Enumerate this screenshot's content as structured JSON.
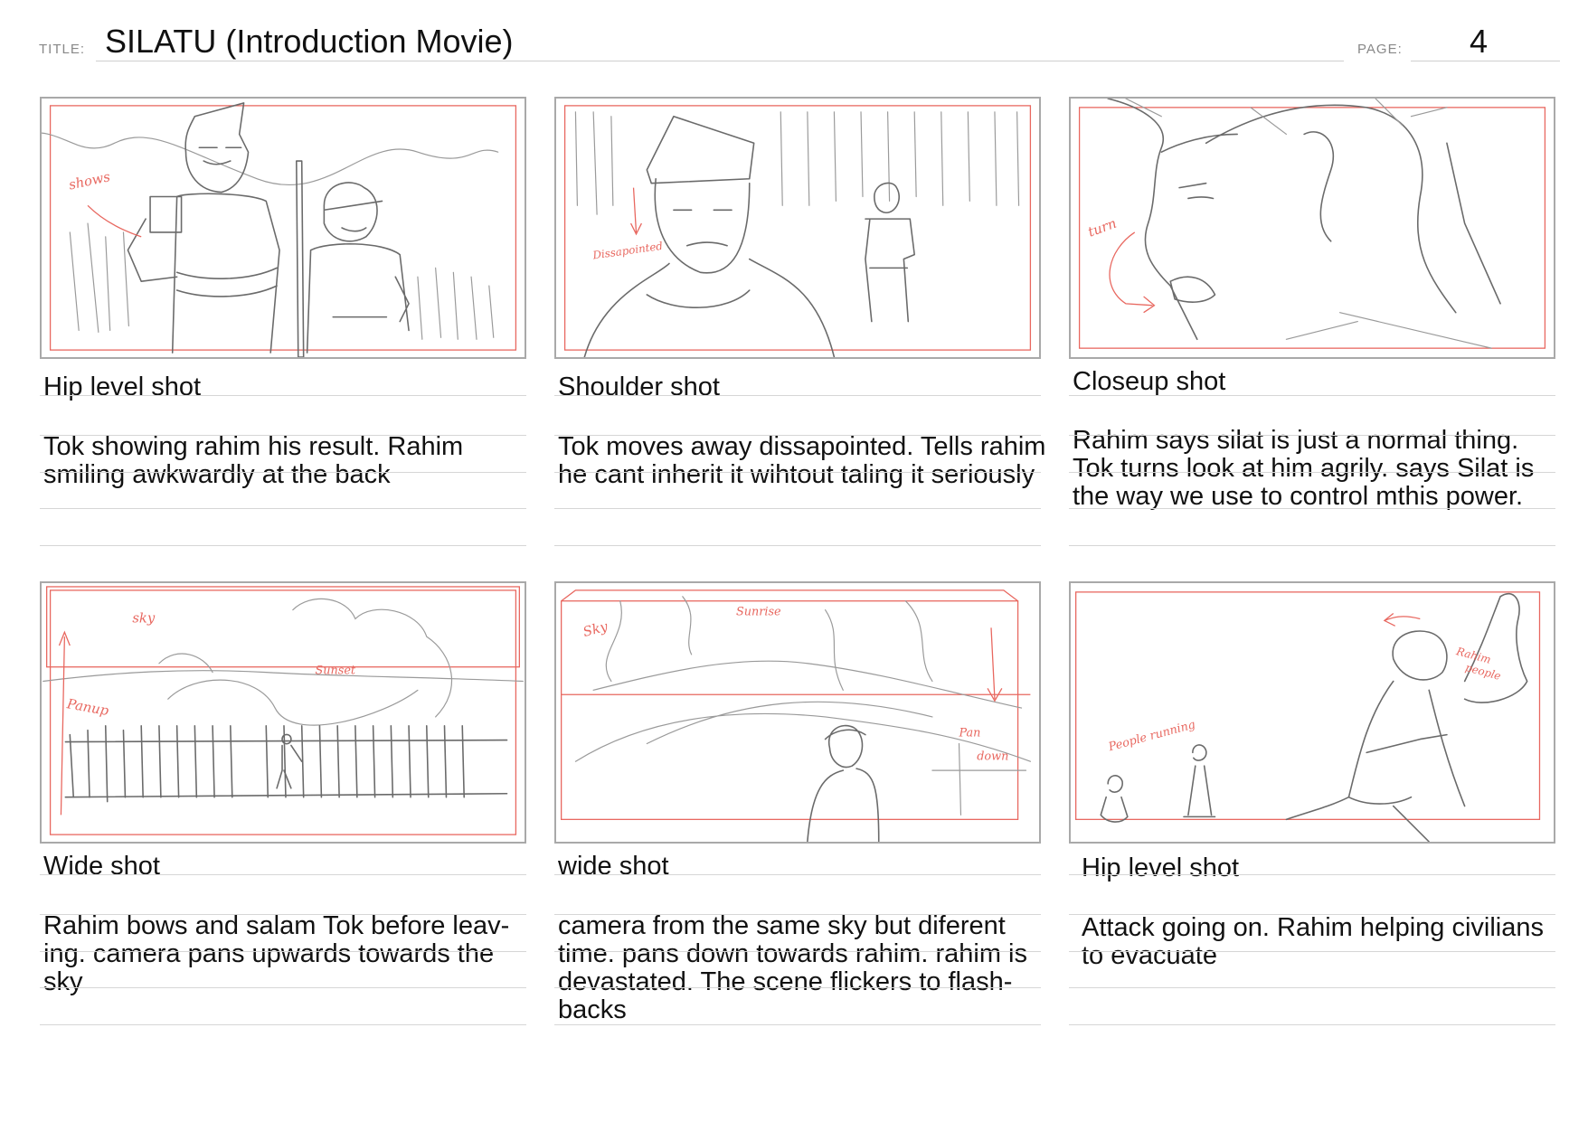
{
  "header": {
    "title_label": "TITLE:",
    "title": "SILATU (Introduction Movie)",
    "page_label": "PAGE:",
    "page_number": "4"
  },
  "panels": [
    {
      "shot": "Hip level shot",
      "description": "Tok showing rahim his result. Rahim smiling awkwardly at the back",
      "annotations": [
        "shows"
      ]
    },
    {
      "shot": "Shoulder shot",
      "description": "Tok moves away dissapointed. Tells rahim he cant inherit it wihtout taling it seriously",
      "annotations": [
        "Dissapointed"
      ]
    },
    {
      "shot": "Closeup shot",
      "description": "Rahim says silat is just a normal thing. Tok turns look at him agrily. says Silat is the way we use to control mthis power.",
      "annotations": [
        "turn"
      ]
    },
    {
      "shot": "Wide shot",
      "description": "Rahim bows and salam Tok before leav-ing. camera pans upwards towards the sky",
      "annotations": [
        "sky",
        "Sunset",
        "Panup"
      ]
    },
    {
      "shot": "wide shot",
      "description": "camera from the  same sky but diferent time. pans down towards rahim. rahim is devastated. The scene flickers to flash-backs",
      "annotations": [
        "Sky",
        "Sunrise",
        "Pan",
        "down"
      ]
    },
    {
      "shot": "Hip level shot",
      "description": "Attack going on. Rahim helping civilians to evacuate",
      "annotations": [
        "People running",
        "Rahim",
        "people"
      ]
    }
  ],
  "colors": {
    "frame": "#a9a9a9",
    "safe_area": "#e8675f",
    "sketch": "#6a6a6a"
  }
}
